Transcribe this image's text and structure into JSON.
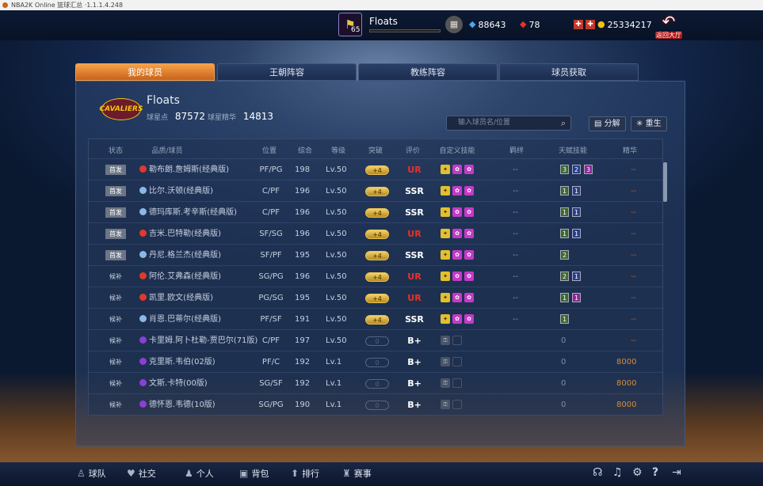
{
  "window": {
    "title": "NBA2K Online 篮球汇总 ·1.1.1.4.248"
  },
  "profile": {
    "name": "Floats",
    "level": "65"
  },
  "currencies": {
    "diamond": "88643",
    "ticket": "78",
    "coin": "25334217"
  },
  "back_label": "返回大厅",
  "tabs": [
    {
      "label": "我的球员",
      "active": true
    },
    {
      "label": "王朝阵容",
      "active": false
    },
    {
      "label": "教练阵容",
      "active": false
    },
    {
      "label": "球员获取",
      "active": false
    }
  ],
  "team": {
    "logo_text": "CAVALIERS",
    "name": "Floats",
    "star_points_label": "球星点",
    "star_points": "87572",
    "essence_label": "球星精华",
    "essence": "14813"
  },
  "search": {
    "placeholder": "输入球员名/位置"
  },
  "actions": {
    "decompose": "分解",
    "rebirth": "重生"
  },
  "columns": [
    "状态",
    "品质/球员",
    "位置",
    "综合",
    "等级",
    "突破",
    "评价",
    "自定义技能",
    "羁绊",
    "天赋技能",
    "精华"
  ],
  "rows": [
    {
      "status": "首发",
      "ball": "red",
      "name": "勒布朗.詹姆斯(经典版)",
      "pos": "PF/PG",
      "ovr": "198",
      "lvl": "Lv.50",
      "break": "+4",
      "grade": "UR",
      "skills": [
        "g",
        "p",
        "p"
      ],
      "bond": "--",
      "talents": [
        [
          "g",
          "3"
        ],
        [
          "b",
          "2"
        ],
        [
          "p",
          "3"
        ]
      ],
      "essence": "--"
    },
    {
      "status": "首发",
      "ball": "blue",
      "name": "比尔.沃顿(经典版)",
      "pos": "C/PF",
      "ovr": "196",
      "lvl": "Lv.50",
      "break": "+4",
      "grade": "SSR",
      "skills": [
        "g",
        "p",
        "p"
      ],
      "bond": "--",
      "talents": [
        [
          "g",
          "1"
        ],
        [
          "b",
          "1"
        ]
      ],
      "essence": "--"
    },
    {
      "status": "首发",
      "ball": "blue",
      "name": "德玛库斯.考辛斯(经典版)",
      "pos": "C/PF",
      "ovr": "196",
      "lvl": "Lv.50",
      "break": "+4",
      "grade": "SSR",
      "skills": [
        "g",
        "p",
        "p"
      ],
      "bond": "--",
      "talents": [
        [
          "g",
          "1"
        ],
        [
          "b",
          "1"
        ]
      ],
      "essence": "--"
    },
    {
      "status": "首发",
      "ball": "red",
      "name": "吉米.巴特勒(经典版)",
      "pos": "SF/SG",
      "ovr": "196",
      "lvl": "Lv.50",
      "break": "+4",
      "grade": "UR",
      "skills": [
        "g",
        "p",
        "p"
      ],
      "bond": "--",
      "talents": [
        [
          "g",
          "1"
        ],
        [
          "b",
          "1"
        ]
      ],
      "essence": "--"
    },
    {
      "status": "首发",
      "ball": "blue",
      "name": "丹尼.格兰杰(经典版)",
      "pos": "SF/PF",
      "ovr": "195",
      "lvl": "Lv.50",
      "break": "+4",
      "grade": "SSR",
      "skills": [
        "g",
        "p",
        "p"
      ],
      "bond": "--",
      "talents": [
        [
          "g",
          "2"
        ]
      ],
      "essence": "--"
    },
    {
      "status": "候补",
      "ball": "red",
      "name": "阿伦.艾弗森(经典版)",
      "pos": "SG/PG",
      "ovr": "196",
      "lvl": "Lv.50",
      "break": "+4",
      "grade": "UR",
      "skills": [
        "g",
        "p",
        "p"
      ],
      "bond": "--",
      "talents": [
        [
          "g",
          "2"
        ],
        [
          "b",
          "1"
        ]
      ],
      "essence": "--"
    },
    {
      "status": "候补",
      "ball": "red",
      "name": "凯里.欧文(经典版)",
      "pos": "PG/SG",
      "ovr": "195",
      "lvl": "Lv.50",
      "break": "+4",
      "grade": "UR",
      "skills": [
        "g",
        "p",
        "p"
      ],
      "bond": "--",
      "talents": [
        [
          "g",
          "1"
        ],
        [
          "p",
          "1"
        ]
      ],
      "essence": "--"
    },
    {
      "status": "候补",
      "ball": "blue",
      "name": "肖恩.巴蒂尔(经典版)",
      "pos": "PF/SF",
      "ovr": "191",
      "lvl": "Lv.50",
      "break": "+4",
      "grade": "SSR",
      "skills": [
        "g",
        "p",
        "p"
      ],
      "bond": "--",
      "talents": [
        [
          "g",
          "1"
        ]
      ],
      "essence": "--"
    },
    {
      "status": "候补",
      "ball": "purple",
      "name": "卡里姆.阿卜杜勒-贾巴尔(71版)",
      "pos": "C/PF",
      "ovr": "197",
      "lvl": "Lv.50",
      "break": "0",
      "grade": "B+",
      "skills": [
        "lock",
        "e"
      ],
      "bond": "",
      "talents": [],
      "talent_zero": "0",
      "essence": "--"
    },
    {
      "status": "候补",
      "ball": "purple",
      "name": "克里斯.韦伯(02版)",
      "pos": "PF/C",
      "ovr": "192",
      "lvl": "Lv.1",
      "break": "0",
      "grade": "B+",
      "skills": [
        "lock",
        "e"
      ],
      "bond": "",
      "talents": [],
      "talent_zero": "0",
      "essence": "8000"
    },
    {
      "status": "候补",
      "ball": "purple",
      "name": "文斯.卡特(00版)",
      "pos": "SG/SF",
      "ovr": "192",
      "lvl": "Lv.1",
      "break": "0",
      "grade": "B+",
      "skills": [
        "lock",
        "e"
      ],
      "bond": "",
      "talents": [],
      "talent_zero": "0",
      "essence": "8000"
    },
    {
      "status": "候补",
      "ball": "purple",
      "name": "德怀恩.韦德(10版)",
      "pos": "SG/PG",
      "ovr": "190",
      "lvl": "Lv.1",
      "break": "0",
      "grade": "B+",
      "skills": [
        "lock",
        "e"
      ],
      "bond": "",
      "talents": [],
      "talent_zero": "0",
      "essence": "8000"
    }
  ],
  "bottom_nav": [
    {
      "label": "球队",
      "icon": "user-icon"
    },
    {
      "label": "社交",
      "icon": "heart-icon"
    },
    {
      "label": "个人",
      "icon": "person-icon"
    },
    {
      "label": "背包",
      "icon": "bag-icon"
    },
    {
      "label": "排行",
      "icon": "trophy-cup-icon"
    },
    {
      "label": "赛事",
      "icon": "trophy-icon"
    }
  ],
  "colors": {
    "accent": "#f0a050",
    "ur": "#e8322a",
    "essence": "#d98a3a"
  }
}
